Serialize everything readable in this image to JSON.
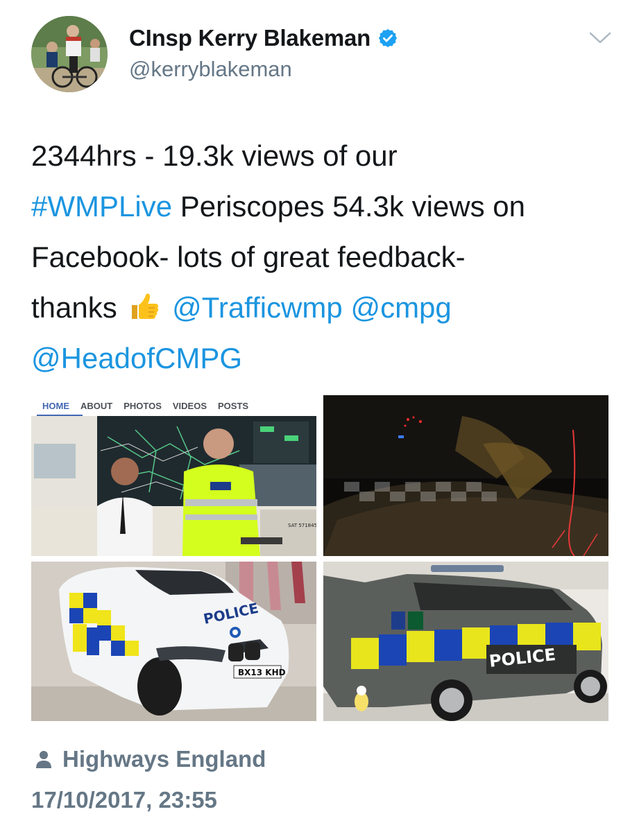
{
  "author": {
    "display_name": "CInsp Kerry Blakeman",
    "handle": "@kerryblakeman",
    "verified": true
  },
  "tweet": {
    "line1": "2344hrs - 19.3k views of our",
    "hashtag": "#WMPLive",
    "line2_rest": " Periscopes 54.3k views on",
    "line3": "Facebook- lots of great feedback-",
    "line4_start": "thanks",
    "emoji": "thumbs-up-icon",
    "mention1": "@Trafficwmp",
    "mention2": "@cmpg",
    "mention3": "@HeadofCMPG"
  },
  "media": {
    "fb_nav": [
      "HOME",
      "ABOUT",
      "PHOTOS",
      "VIDEOS",
      "POSTS"
    ],
    "plate_bmw": "BX13 KHD",
    "police_label": "POLICE",
    "screen_code": "SAT 571845"
  },
  "footer": {
    "location": "Highways England",
    "timestamp": "17/10/2017, 23:55"
  },
  "colors": {
    "link": "#1b95e0",
    "secondary": "#657786",
    "verified": "#1da1f2"
  }
}
